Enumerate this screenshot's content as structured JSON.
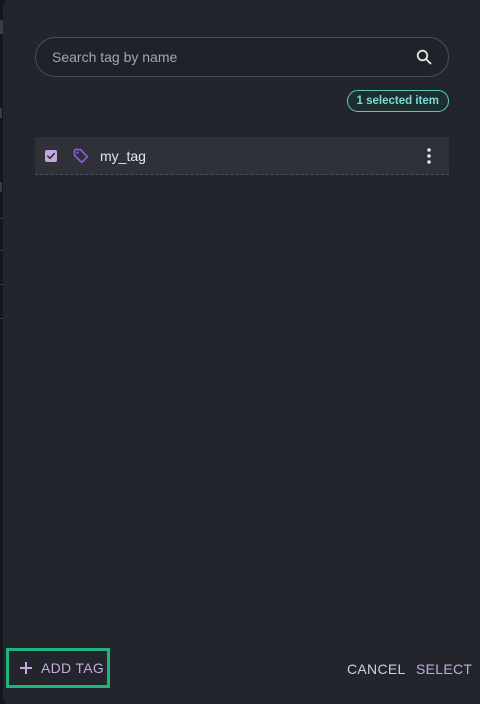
{
  "search": {
    "placeholder": "Search tag by name",
    "value": ""
  },
  "selection": {
    "badge_text": "1 selected item"
  },
  "tags": [
    {
      "name": "my_tag",
      "checked": true,
      "icon": "tag-icon"
    }
  ],
  "footer": {
    "add_tag_label": "ADD TAG",
    "cancel_label": "CANCEL",
    "select_label": "SELECT"
  },
  "colors": {
    "dialog_bg": "#22252c",
    "accent_purple": "#c8a9e2",
    "badge_teal": "#5fc7c0",
    "highlight_green": "#1fb47c"
  }
}
